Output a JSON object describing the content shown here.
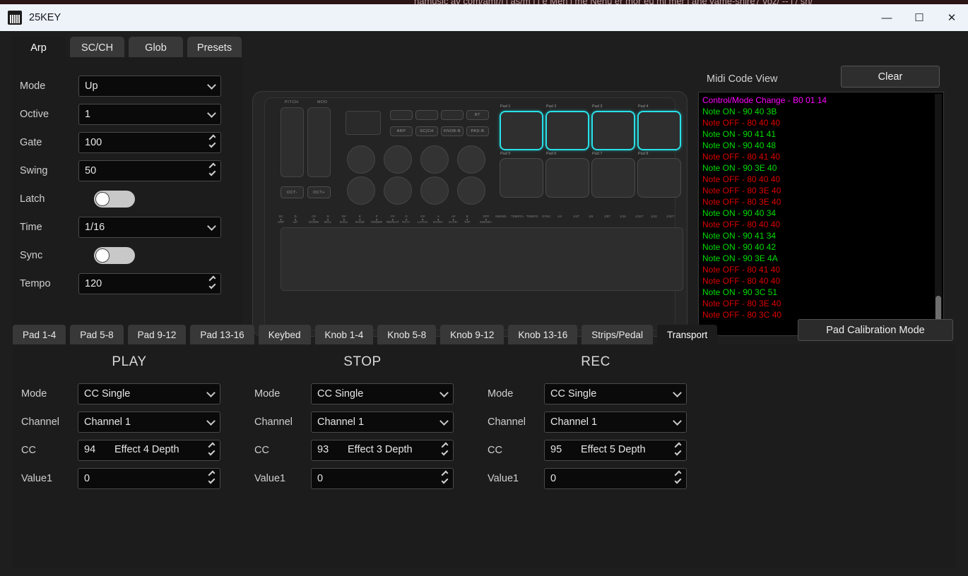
{
  "background_window": {
    "title_fragment": "namusic av com/amr/i i as/m i i e Men i me Nenu er mor eu mi mer i ane vame-snire7 voz/ -- i / sn/"
  },
  "window": {
    "title": "25KEY",
    "icon": "piano-keys-icon",
    "minimize": "—",
    "maximize": "☐",
    "close": "✕"
  },
  "top_tabs": [
    {
      "label": "Arp",
      "active": true
    },
    {
      "label": "SC/CH",
      "active": false
    },
    {
      "label": "Glob",
      "active": false
    },
    {
      "label": "Presets",
      "active": false
    }
  ],
  "arp": {
    "mode": {
      "label": "Mode",
      "value": "Up",
      "type": "select"
    },
    "octive": {
      "label": "Octive",
      "value": "1",
      "type": "select"
    },
    "gate": {
      "label": "Gate",
      "value": "100",
      "type": "spin"
    },
    "swing": {
      "label": "Swing",
      "value": "50",
      "type": "spin"
    },
    "latch": {
      "label": "Latch",
      "value": "off",
      "type": "toggle"
    },
    "time": {
      "label": "Time",
      "value": "1/16",
      "type": "select"
    },
    "sync": {
      "label": "Sync",
      "value": "off",
      "type": "toggle"
    },
    "tempo": {
      "label": "Tempo",
      "value": "120",
      "type": "spin"
    }
  },
  "device": {
    "pitch_label": "PITCH",
    "mod_label": "MOD",
    "oct_down": "OCT-",
    "oct_up": "OCT+",
    "mode_buttons_top": [
      "",
      "",
      "",
      "BT"
    ],
    "mode_buttons_bottom": [
      "ARP",
      "SC|CH",
      "KNOB-B",
      "PAD-B"
    ],
    "pads": [
      {
        "label": "Pad 1",
        "lit": true
      },
      {
        "label": "Pad 2",
        "lit": true
      },
      {
        "label": "Pad 3",
        "lit": true
      },
      {
        "label": "Pad 4",
        "lit": true
      },
      {
        "label": "Pad 5",
        "lit": false
      },
      {
        "label": "Pad 6",
        "lit": false
      },
      {
        "label": "Pad 7",
        "lit": false
      },
      {
        "label": "Pad 8",
        "lit": false
      }
    ],
    "legend": [
      {
        "note": "SC",
        "fn": "ARP"
      },
      {
        "note": "D",
        "fn": "UP"
      },
      {
        "note": "C#",
        "fn": "DOWN"
      },
      {
        "note": "D",
        "fn": "INCL"
      },
      {
        "note": "D#",
        "fn": "EXCL"
      },
      {
        "note": "E",
        "fn": "RAND"
      },
      {
        "note": "F",
        "fn": "ORDER"
      },
      {
        "note": "F#",
        "fn": "REPEAT"
      },
      {
        "note": "G",
        "fn": "OCT+"
      },
      {
        "note": "G#",
        "fn": "LATCH"
      },
      {
        "note": "A",
        "fn": "GATE+"
      },
      {
        "note": "A#",
        "fn": "GATE-"
      },
      {
        "note": "B",
        "fn": "TAP"
      },
      {
        "note": "OFF",
        "fn": "SWING+"
      },
      {
        "note": "",
        "fn": "SWING-"
      },
      {
        "note": "",
        "fn": "TEMPO+"
      },
      {
        "note": "",
        "fn": "TEMPO-"
      },
      {
        "note": "",
        "fn": "SYNC"
      },
      {
        "note": "",
        "fn": "1/4"
      },
      {
        "note": "",
        "fn": "1/4T"
      },
      {
        "note": "",
        "fn": "1/8"
      },
      {
        "note": "",
        "fn": "1/8T"
      },
      {
        "note": "",
        "fn": "1/16"
      },
      {
        "note": "",
        "fn": "1/16T"
      },
      {
        "note": "",
        "fn": "1/32"
      },
      {
        "note": "",
        "fn": "1/32T"
      }
    ]
  },
  "midi": {
    "header": "Midi Code View",
    "clear_label": "Clear",
    "colors": {
      "control": "#ff00ff",
      "note_on": "#00dd00",
      "note_off": "#dd0000"
    },
    "lines": [
      {
        "text": "Control/Mode Change - B0 01 14",
        "kind": "control"
      },
      {
        "text": "Note ON - 90 40 3B",
        "kind": "on"
      },
      {
        "text": "Note OFF - 80 40 40",
        "kind": "off"
      },
      {
        "text": "Note ON - 90 41 41",
        "kind": "on"
      },
      {
        "text": "Note ON - 90 40 48",
        "kind": "on"
      },
      {
        "text": "Note OFF - 80 41 40",
        "kind": "off"
      },
      {
        "text": "Note ON - 90 3E 40",
        "kind": "on"
      },
      {
        "text": "Note OFF - 80 40 40",
        "kind": "off"
      },
      {
        "text": "Note OFF - 80 3E 40",
        "kind": "off"
      },
      {
        "text": "Note OFF - 80 3E 40",
        "kind": "off"
      },
      {
        "text": "Note ON - 90 40 34",
        "kind": "on"
      },
      {
        "text": "Note OFF - 80 40 40",
        "kind": "off"
      },
      {
        "text": "Note ON - 90 41 34",
        "kind": "on"
      },
      {
        "text": "Note ON - 90 40 42",
        "kind": "on"
      },
      {
        "text": "Note ON - 90 3E 4A",
        "kind": "on"
      },
      {
        "text": "Note OFF - 80 41 40",
        "kind": "off"
      },
      {
        "text": "Note OFF - 80 40 40",
        "kind": "off"
      },
      {
        "text": "Note ON - 90 3C 51",
        "kind": "on"
      },
      {
        "text": "Note OFF - 80 3E 40",
        "kind": "off"
      },
      {
        "text": "Note OFF - 80 3C 40",
        "kind": "off"
      }
    ]
  },
  "bottom_tabs": [
    {
      "label": "Pad 1-4",
      "active": false
    },
    {
      "label": "Pad 5-8",
      "active": false
    },
    {
      "label": "Pad 9-12",
      "active": false
    },
    {
      "label": "Pad 13-16",
      "active": false
    },
    {
      "label": "Keybed",
      "active": false
    },
    {
      "label": "Knob 1-4",
      "active": false
    },
    {
      "label": "Knob 5-8",
      "active": false
    },
    {
      "label": "Knob 9-12",
      "active": false
    },
    {
      "label": "Knob 13-16",
      "active": false
    },
    {
      "label": "Strips/Pedal",
      "active": false
    },
    {
      "label": "Transport",
      "active": true
    }
  ],
  "calibration_button": "Pad Calibration Mode",
  "transport": {
    "labels": {
      "mode": "Mode",
      "channel": "Channel",
      "cc": "CC",
      "value1": "Value1"
    },
    "sections": [
      {
        "title": "PLAY",
        "mode": "CC Single",
        "channel": "Channel 1",
        "cc_number": "94",
        "cc_name": "Effect 4 Depth",
        "value1": "0"
      },
      {
        "title": "STOP",
        "mode": "CC Single",
        "channel": "Channel 1",
        "cc_number": "93",
        "cc_name": "Effect 3 Depth",
        "value1": "0"
      },
      {
        "title": "REC",
        "mode": "CC Single",
        "channel": "Channel 1",
        "cc_number": "95",
        "cc_name": "Effect 5 Depth",
        "value1": "0"
      }
    ]
  }
}
